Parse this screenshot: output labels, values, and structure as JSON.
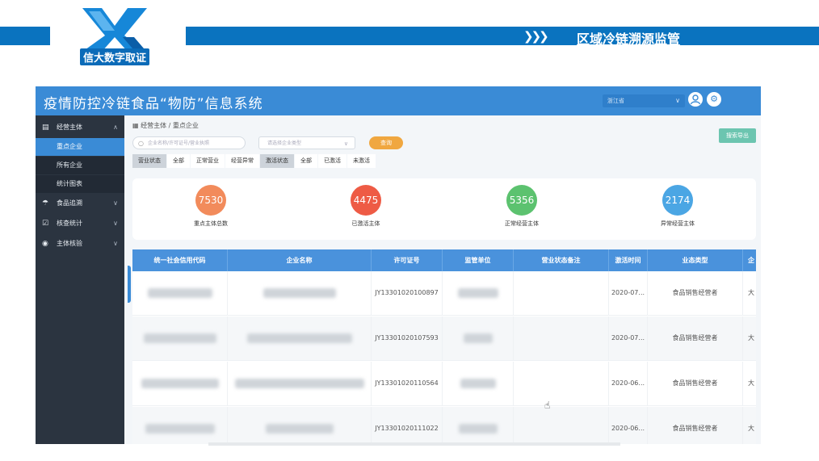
{
  "slide": {
    "logo_text": "信大数字取证",
    "title": "区域冷链溯源监管",
    "arrows": "❯❯❯",
    "colors": {
      "brand_blue": "#0a73bf"
    }
  },
  "app": {
    "title": "疫情防控冷链食品“物防”信息系统",
    "province": "浙江省",
    "user_icon": "user-icon",
    "settings_icon": "gear-icon"
  },
  "sidebar": {
    "groups": [
      {
        "label": "经营主体",
        "icon": "document-icon",
        "expanded": true
      },
      {
        "label": "食品追溯",
        "icon": "umbrella-icon",
        "expanded": false
      },
      {
        "label": "核查统计",
        "icon": "checkbox-icon",
        "expanded": false
      },
      {
        "label": "主体核验",
        "icon": "eye-icon",
        "expanded": false
      }
    ],
    "subitems": [
      {
        "label": "重点企业",
        "active": true
      },
      {
        "label": "所有企业",
        "active": false
      },
      {
        "label": "统计图表",
        "active": false
      }
    ]
  },
  "main": {
    "breadcrumb": "经营主体  /  重点企业",
    "export_label": "搜索导出",
    "search_placeholder": "企业名称/许可证号/营业执照",
    "type_placeholder": "请选择企业类型",
    "query_label": "查询",
    "filters": {
      "business_status_label": "营业状态",
      "business_options": [
        "全部",
        "正常营业",
        "经营异常"
      ],
      "activation_status_label": "激活状态",
      "activation_options": [
        "全部",
        "已激活",
        "未激活"
      ]
    },
    "stats": [
      {
        "value": "7530",
        "label": "重点主体总数",
        "color": "#f28b5b"
      },
      {
        "value": "4475",
        "label": "已激活主体",
        "color": "#ee5b45"
      },
      {
        "value": "5356",
        "label": "正常经营主体",
        "color": "#5cc26f"
      },
      {
        "value": "2174",
        "label": "异常经营主体",
        "color": "#4ba6e4"
      }
    ]
  },
  "table": {
    "headers": [
      "统一社会信用代码",
      "企业名称",
      "许可证号",
      "监管单位",
      "营业状态备注",
      "激活时间",
      "业态类型",
      "企"
    ],
    "rows": [
      {
        "license": "JY13301020100897",
        "activated": "2020-07...",
        "type": "食品销售经营者",
        "last": "大"
      },
      {
        "license": "JY13301020107593",
        "activated": "2020-07...",
        "type": "食品销售经营者",
        "last": "大"
      },
      {
        "license": "JY13301020110564",
        "activated": "2020-06...",
        "type": "食品销售经营者",
        "last": "大"
      },
      {
        "license": "JY13301020111022",
        "activated": "2020-06...",
        "type": "食品销售经营者",
        "last": "大"
      }
    ]
  }
}
